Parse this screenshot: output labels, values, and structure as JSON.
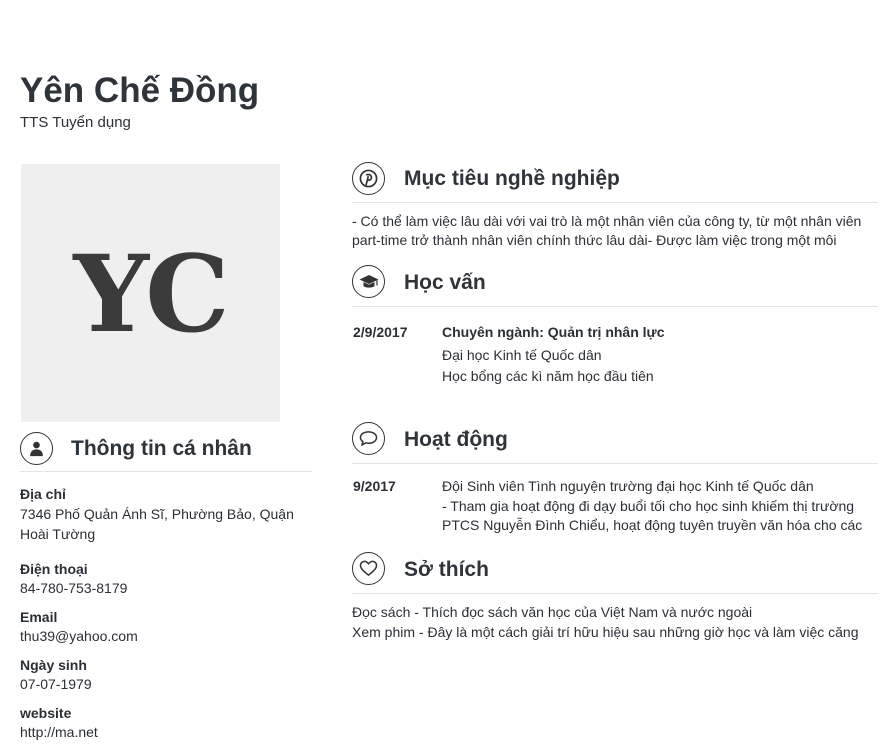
{
  "header": {
    "name": "Yên Chế Đồng",
    "job_title": "TTS Tuyển dụng"
  },
  "avatar": {
    "initials": "YC"
  },
  "personal": {
    "title": "Thông tin cá nhân",
    "icon": "user-icon",
    "fields": [
      {
        "label": "Địa chỉ",
        "value": "7346 Phố Quản Ánh Sĩ, Phường Bảo, Quận Hoài Tường"
      },
      {
        "label": "Điện thoại",
        "value": "84-780-753-8179"
      },
      {
        "label": "Email",
        "value": "thu39@yahoo.com"
      },
      {
        "label": "Ngày sinh",
        "value": "07-07-1979"
      },
      {
        "label": "website",
        "value": "http://ma.net"
      }
    ]
  },
  "objective": {
    "title": "Mục tiêu nghề nghiệp",
    "icon": "pinterest-icon",
    "lines": [
      "- Có thể làm việc lâu dài với vai trò là một nhân viên của công ty, từ một nhân viên",
      "part-time trở thành nhân viên chính thức lâu dài- Được làm việc trong một môi"
    ]
  },
  "education": {
    "title": "Học vấn",
    "icon": "graduation-cap-icon",
    "entries": [
      {
        "date": "2/9/2017",
        "heading": "Chuyên ngành: Quản trị nhân lực",
        "lines": [
          "Đại học Kinh tế Quốc dân",
          "Học bổng các kì năm học đầu tiên"
        ]
      }
    ]
  },
  "activities": {
    "title": "Hoạt động",
    "icon": "speech-bubble-icon",
    "entries": [
      {
        "date": "9/2017",
        "lines": [
          "Đội Sinh viên Tình nguyện trường đại học Kinh tế Quốc dân",
          "- Tham gia hoạt động đi dạy buổi tối cho học sinh khiếm thị trường",
          "PTCS Nguyễn Đình Chiểu, hoạt động tuyên truyền văn hóa cho các"
        ]
      }
    ]
  },
  "hobbies": {
    "title": "Sở thích",
    "icon": "heart-icon",
    "lines": [
      "Đọc sách - Thích đọc sách văn học của Việt Nam và nước ngoài",
      "Xem phim - Đây là một cách giải trí hữu hiệu sau những giờ học và làm việc căng"
    ]
  }
}
